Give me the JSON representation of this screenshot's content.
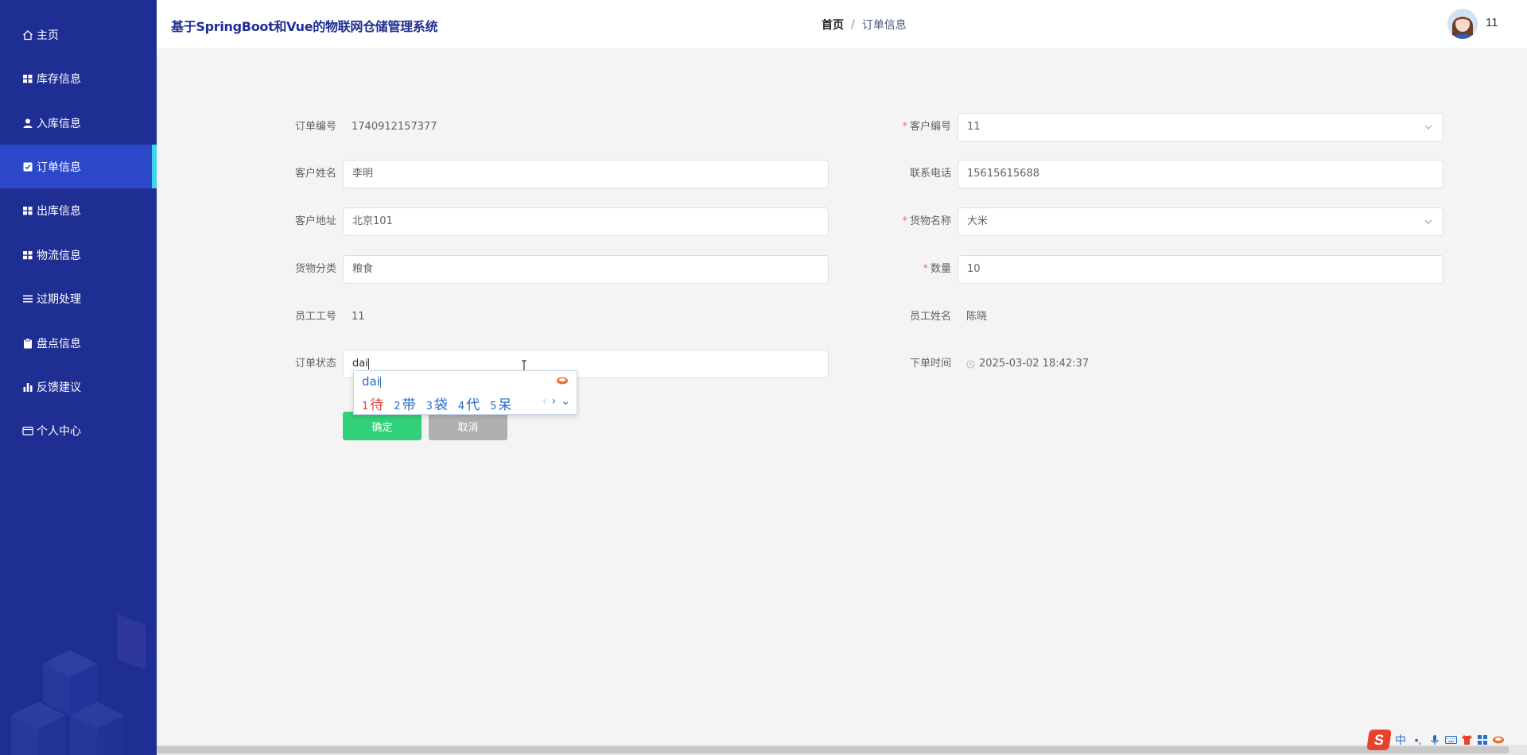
{
  "app": {
    "title": "基于SpringBoot和Vue的物联网仓储管理系统"
  },
  "breadcrumb": {
    "home": "首页",
    "separator": "/",
    "current": "订单信息"
  },
  "user": {
    "name": "11"
  },
  "sidebar": {
    "items": [
      {
        "label": "主页",
        "icon": "home-icon"
      },
      {
        "label": "库存信息",
        "icon": "grid-icon"
      },
      {
        "label": "入库信息",
        "icon": "user-icon"
      },
      {
        "label": "订单信息",
        "icon": "checkbox-icon",
        "active": true
      },
      {
        "label": "出库信息",
        "icon": "grid-icon"
      },
      {
        "label": "物流信息",
        "icon": "grid-icon"
      },
      {
        "label": "过期处理",
        "icon": "list-icon"
      },
      {
        "label": "盘点信息",
        "icon": "clipboard-icon"
      },
      {
        "label": "反馈建议",
        "icon": "bar-chart-icon"
      },
      {
        "label": "个人中心",
        "icon": "card-icon"
      }
    ]
  },
  "form": {
    "order_no": {
      "label": "订单编号",
      "value": "1740912157377"
    },
    "customer_no": {
      "label": "客户编号",
      "value": "11",
      "required": true
    },
    "customer_name": {
      "label": "客户姓名",
      "value": "李明"
    },
    "phone": {
      "label": "联系电话",
      "value": "15615615688"
    },
    "address": {
      "label": "客户地址",
      "value": "北京101"
    },
    "goods_name": {
      "label": "货物名称",
      "value": "大米",
      "required": true
    },
    "category": {
      "label": "货物分类",
      "value": "粮食"
    },
    "quantity": {
      "label": "数量",
      "value": "10",
      "required": true
    },
    "staff_no": {
      "label": "员工工号",
      "value": "11"
    },
    "staff_name": {
      "label": "员工姓名",
      "value": "陈晓"
    },
    "status": {
      "label": "订单状态",
      "value": "dai"
    },
    "order_time": {
      "label": "下单时间",
      "value": "2025-03-02 18:42:37"
    },
    "required_mark": "*"
  },
  "buttons": {
    "confirm": "确定",
    "cancel": "取消"
  },
  "ime": {
    "composition": "dai",
    "candidates": [
      {
        "n": "1",
        "text": "待"
      },
      {
        "n": "2",
        "text": "带"
      },
      {
        "n": "3",
        "text": "袋"
      },
      {
        "n": "4",
        "text": "代"
      },
      {
        "n": "5",
        "text": "呆"
      }
    ],
    "prev": "‹",
    "next": "›",
    "expand": "⌄"
  },
  "tray": {
    "logo": "S",
    "mode": "中",
    "punct": "•,"
  },
  "colors": {
    "sidebar": "#1f2e93",
    "active": "#2c48c9",
    "accent": "#39d6ef",
    "confirm": "#33d07b",
    "cancel": "#b0b0b0"
  }
}
